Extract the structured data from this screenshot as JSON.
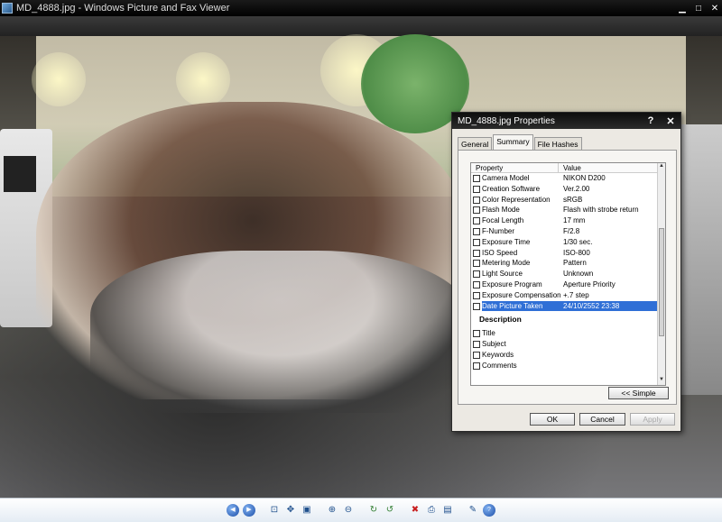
{
  "window": {
    "title": "MD_4888.jpg - Windows Picture and Fax Viewer",
    "controls": {
      "minimize": "▁",
      "maximize": "□",
      "close": "✕"
    }
  },
  "dialog": {
    "title": "MD_4888.jpg Properties",
    "help": "?",
    "close": "✕",
    "tabs": [
      {
        "label": "General",
        "active": false
      },
      {
        "label": "Summary",
        "active": true
      },
      {
        "label": "File Hashes",
        "active": false
      }
    ],
    "columns": {
      "property": "Property",
      "value": "Value"
    },
    "rows": [
      {
        "property": "Camera Model",
        "value": "NIKON D200"
      },
      {
        "property": "Creation Software",
        "value": "Ver.2.00"
      },
      {
        "property": "Color Representation",
        "value": "sRGB"
      },
      {
        "property": "Flash Mode",
        "value": "Flash with strobe return"
      },
      {
        "property": "Focal Length",
        "value": "17 mm"
      },
      {
        "property": "F-Number",
        "value": "F/2.8"
      },
      {
        "property": "Exposure Time",
        "value": "1/30 sec."
      },
      {
        "property": "ISO Speed",
        "value": "ISO-800"
      },
      {
        "property": "Metering Mode",
        "value": "Pattern"
      },
      {
        "property": "Light Source",
        "value": "Unknown"
      },
      {
        "property": "Exposure Program",
        "value": "Aperture Priority"
      },
      {
        "property": "Exposure Compensation",
        "value": "+.7 step"
      },
      {
        "property": "Date Picture Taken",
        "value": "24/10/2552 23:38",
        "selected": true
      }
    ],
    "description_header": "Description",
    "description_rows": [
      {
        "property": "Title"
      },
      {
        "property": "Subject"
      },
      {
        "property": "Keywords"
      },
      {
        "property": "Comments"
      }
    ],
    "simple_button": "<< Simple",
    "ok_button": "OK",
    "cancel_button": "Cancel",
    "apply_button": "Apply"
  },
  "toolbar": {
    "buttons": [
      {
        "name": "previous-image-icon",
        "glyph": "◀"
      },
      {
        "name": "next-image-icon",
        "glyph": "▶"
      },
      {
        "name": "best-fit-icon",
        "glyph": "⊡"
      },
      {
        "name": "actual-size-icon",
        "glyph": "✥"
      },
      {
        "name": "slideshow-icon",
        "glyph": "▣"
      },
      {
        "name": "zoom-in-icon",
        "glyph": "⊕"
      },
      {
        "name": "zoom-out-icon",
        "glyph": "⊖"
      },
      {
        "name": "rotate-clockwise-icon",
        "glyph": "↻"
      },
      {
        "name": "rotate-counterclockwise-icon",
        "glyph": "↺"
      },
      {
        "name": "delete-icon",
        "glyph": "✖"
      },
      {
        "name": "print-icon",
        "glyph": "⎙"
      },
      {
        "name": "save-icon",
        "glyph": "▤"
      },
      {
        "name": "edit-icon",
        "glyph": "✎"
      },
      {
        "name": "help-icon",
        "glyph": "?"
      }
    ]
  }
}
